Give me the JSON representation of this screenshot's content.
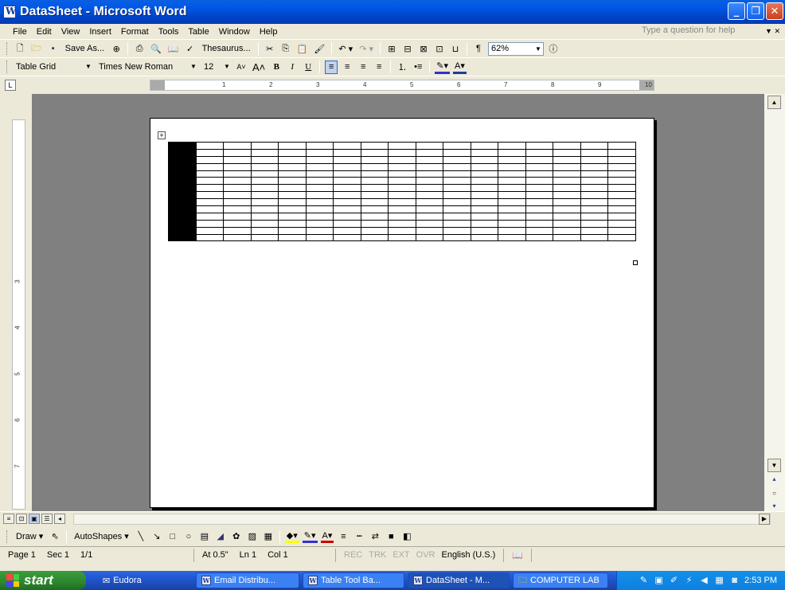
{
  "window": {
    "title": "DataSheet - Microsoft Word",
    "minimize": "_",
    "maximize": "❐",
    "close": "✕"
  },
  "menu": {
    "items": [
      "File",
      "Edit",
      "View",
      "Insert",
      "Format",
      "Tools",
      "Table",
      "Window",
      "Help"
    ],
    "help_placeholder": "Type a question for help"
  },
  "standard_toolbar": {
    "save_as": "Save As...",
    "thesaurus": "Thesaurus...",
    "zoom": "62%",
    "pilcrow": "¶"
  },
  "formatting_toolbar": {
    "style": "Table Grid",
    "font": "Times New Roman",
    "size": "12",
    "bold": "B",
    "italic": "I",
    "underline": "U"
  },
  "ruler": {
    "h_numbers": [
      "1",
      "2",
      "3",
      "4",
      "5",
      "6",
      "7",
      "8",
      "9",
      "10"
    ],
    "v_numbers": [
      "3",
      "4",
      "5",
      "6",
      "7"
    ]
  },
  "table": {
    "rows": 14,
    "cols": 17,
    "selected_column": 0
  },
  "draw_toolbar": {
    "draw": "Draw",
    "autoshapes": "AutoShapes"
  },
  "status": {
    "page": "Page 1",
    "sec": "Sec 1",
    "pages": "1/1",
    "at": "At 0.5\"",
    "ln": "Ln 1",
    "col": "Col 1",
    "rec": "REC",
    "trk": "TRK",
    "ext": "EXT",
    "ovr": "OVR",
    "language": "English (U.S.)"
  },
  "taskbar": {
    "start": "start",
    "tasks": [
      "Eudora",
      "Email Distribu...",
      "Table Tool Ba...",
      "DataSheet - M...",
      "COMPUTER LAB"
    ],
    "clock": "2:53 PM"
  }
}
